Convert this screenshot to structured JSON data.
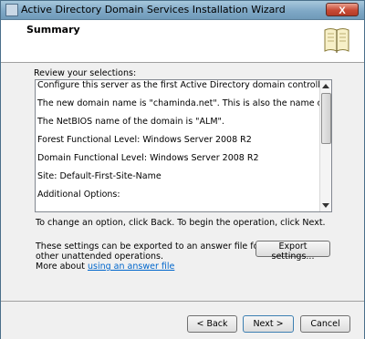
{
  "window": {
    "title": "Active Directory Domain Services Installation Wizard",
    "close_label": "X"
  },
  "header": {
    "title": "Summary",
    "icon": "book-icon"
  },
  "content": {
    "review_label": "Review your selections:",
    "summary_lines": [
      "Configure this server as the first Active Directory domain controller in a new forest.",
      "The new domain name is \"chaminda.net\". This is also the name of the new forest.",
      "The NetBIOS name of the domain is \"ALM\".",
      "Forest Functional Level: Windows Server 2008 R2",
      "Domain Functional Level: Windows Server 2008 R2",
      "Site: Default-First-Site-Name",
      "Additional Options:"
    ],
    "change_hint": "To change an option, click Back. To begin the operation, click Next.",
    "export_text_line1": "These settings can be exported to an answer file for use with",
    "export_text_line2": "other unattended operations.",
    "more_about": "More about ",
    "answer_file_link": "using an answer file",
    "export_button": "Export settings..."
  },
  "footer": {
    "back_label": "< Back",
    "next_label": "Next >",
    "cancel_label": "Cancel"
  }
}
